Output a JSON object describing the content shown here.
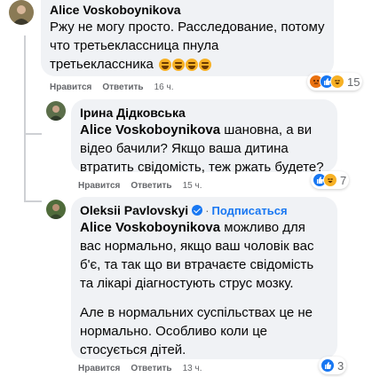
{
  "comments": [
    {
      "author": "Alice Voskoboynikova",
      "text": "Ржу не могу просто. Расследование, потому что третьеклассница пнула третьеклассника",
      "emoji": [
        "laugh-emoji",
        "laugh-emoji",
        "laugh-emoji",
        "laugh-emoji"
      ],
      "like_label": "Нравится",
      "reply_label": "Ответить",
      "time": "16 ч.",
      "reactions": [
        "angry",
        "like",
        "haha"
      ],
      "reaction_count": "15"
    },
    {
      "author": "Ірина Дідковська",
      "mention": "Alice Voskoboynikova",
      "text": "шановна, а ви відео бачили? Якщо ваша дитина втратить свідомість, теж ржать будете?",
      "like_label": "Нравится",
      "reply_label": "Ответить",
      "time": "15 ч.",
      "reactions": [
        "like",
        "haha"
      ],
      "reaction_count": "7"
    },
    {
      "author": "Oleksii Pavlovskyi",
      "follow_label": "Подписаться",
      "mention": "Alice Voskoboynikova",
      "text": "можливо для вас нормально, якщо ваш чоловік вас б'є, та так що ви втрачаєте свідомість та лікарі діагностують струс мозку.",
      "text2": "Але в нормальних суспільствах це не нормально. Особливо коли це стосується дітей.",
      "like_label": "Нравится",
      "reply_label": "Ответить",
      "time": "13 ч.",
      "reactions": [
        "like"
      ],
      "reaction_count": "3"
    }
  ],
  "colors": {
    "bubble": "#f0f2f5",
    "link": "#1877f2",
    "meta": "#65676b"
  }
}
